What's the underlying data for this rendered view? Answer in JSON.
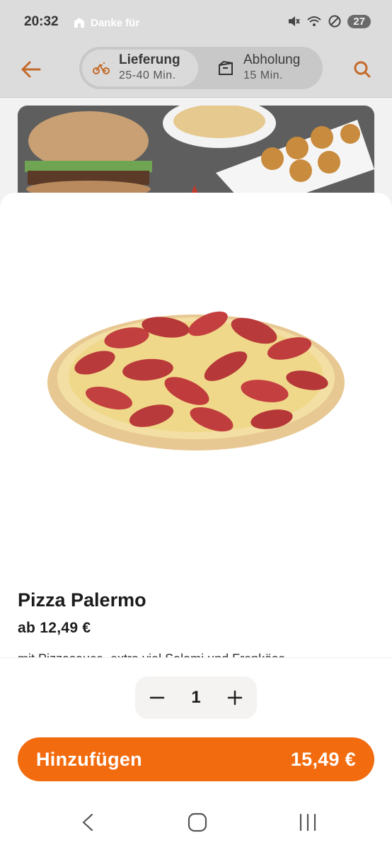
{
  "status_bar": {
    "time": "20:32",
    "notification_text": "Danke für",
    "battery": "27",
    "icons": [
      "restaurant-icon",
      "mute-icon",
      "wifi-icon",
      "dnd-icon"
    ]
  },
  "top_bar": {
    "delivery": {
      "title": "Lieferung",
      "subtitle": "25-40 Min.",
      "icon": "bike-icon"
    },
    "pickup": {
      "title": "Abholung",
      "subtitle": "15 Min.",
      "icon": "bag-icon"
    }
  },
  "product": {
    "name": "Pizza Palermo",
    "price": "ab 12,49 €",
    "description": "mit Pizzasauce, extra viel Salami und Frenkäse"
  },
  "quantity": {
    "value": "1"
  },
  "add_button": {
    "label": "Hinzufügen",
    "price": "15,49 €"
  },
  "colors": {
    "accent": "#f26b0f",
    "accent_dim": "#c46a2a"
  }
}
